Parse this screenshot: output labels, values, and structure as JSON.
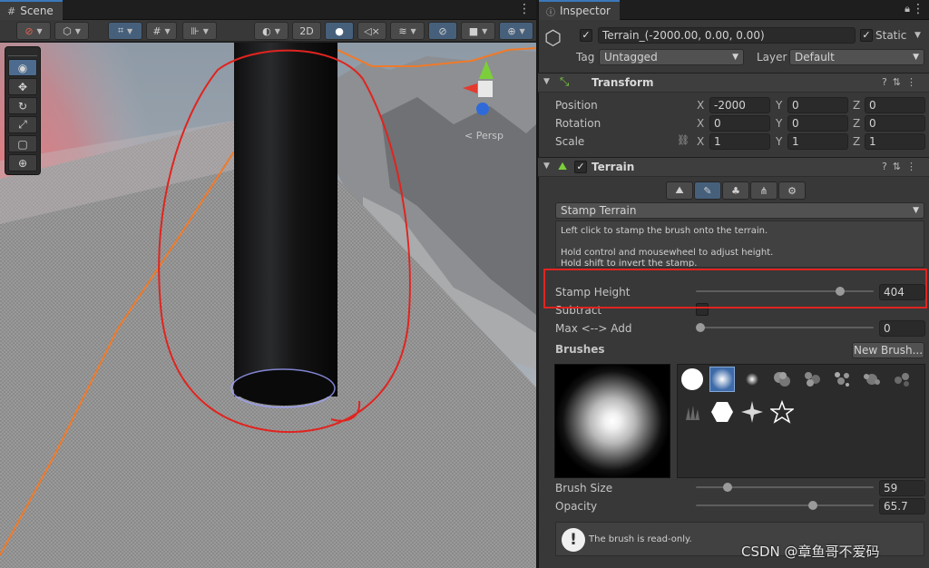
{
  "scene": {
    "tab_label": "Scene",
    "toolbar": {
      "mode_2d": "2D"
    },
    "persp_label": "< Persp",
    "tools": [
      "view-tool",
      "move-tool",
      "rotate-tool",
      "scale-tool",
      "rect-tool",
      "transform-tool"
    ]
  },
  "inspector": {
    "tab_label": "Inspector",
    "object": {
      "active": true,
      "name": "Terrain_(-2000.00, 0.00, 0.00)",
      "static_checked": true,
      "static_label": "Static",
      "tag_label": "Tag",
      "tag_value": "Untagged",
      "layer_label": "Layer",
      "layer_value": "Default"
    },
    "transform": {
      "title": "Transform",
      "position_label": "Position",
      "rotation_label": "Rotation",
      "scale_label": "Scale",
      "axis_x": "X",
      "axis_y": "Y",
      "axis_z": "Z",
      "position": {
        "x": "-2000",
        "y": "0",
        "z": "0"
      },
      "rotation": {
        "x": "0",
        "y": "0",
        "z": "0"
      },
      "scale": {
        "x": "1",
        "y": "1",
        "z": "1"
      }
    },
    "terrain": {
      "title": "Terrain",
      "enabled": true,
      "tool_dropdown": "Stamp Terrain",
      "help_lines": [
        "Left click to stamp the brush onto the terrain.",
        "",
        "Hold control and mousewheel to adjust height.",
        "Hold shift to invert the stamp."
      ],
      "stamp_height_label": "Stamp Height",
      "stamp_height_value": "404",
      "stamp_height_fraction": 0.9,
      "subtract_label": "Subtract",
      "subtract_checked": false,
      "max_add_label": "Max <--> Add",
      "max_add_value": "0",
      "max_add_fraction": 0.0,
      "brushes_label": "Brushes",
      "new_brush_label": "New Brush...",
      "brush_size_label": "Brush Size",
      "brush_size_value": "59",
      "brush_size_fraction": 0.18,
      "opacity_label": "Opacity",
      "opacity_value": "65.7",
      "opacity_fraction": 0.657,
      "readonly_note": "The brush is read-only."
    }
  },
  "watermark": "CSDN @章鱼哥不爱码",
  "colors": {
    "annotation_red": "#e0241f",
    "selection_orange": "#f07a2a",
    "accent_blue": "#3a79bb"
  }
}
